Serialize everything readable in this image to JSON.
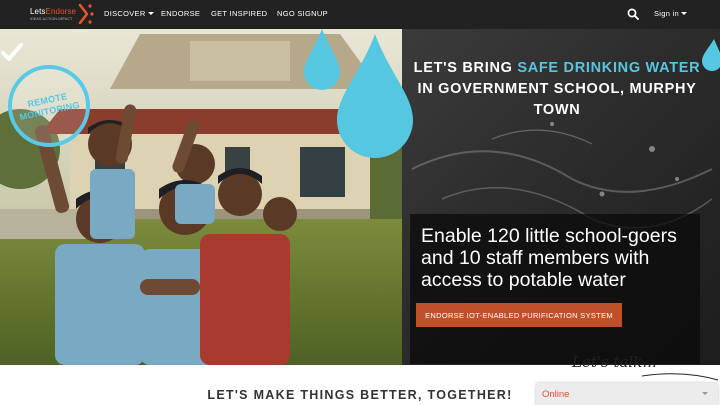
{
  "brand": {
    "name_part1": "Lets",
    "name_part2": "Endorse",
    "tagline": "IDEAS.ACTION.IMPACT",
    "accent": "#e8542a"
  },
  "nav": {
    "items": [
      {
        "label": "DISCOVER",
        "has_dropdown": true
      },
      {
        "label": "ENDORSE",
        "has_dropdown": false
      },
      {
        "label": "GET INSPIRED",
        "has_dropdown": false
      },
      {
        "label": "NGO SIGNUP",
        "has_dropdown": false
      }
    ],
    "search_icon": "search-icon",
    "signin_label": "Sign in"
  },
  "hero": {
    "badge": {
      "line1": "REMOTE",
      "line2": "MONITORING",
      "color": "#56c7e0"
    },
    "headline": {
      "part1": "LET'S BRING ",
      "highlight": "SAFE DRINKING WATER",
      "part2": " IN GOVERNMENT SCHOOL, MURPHY TOWN",
      "highlight_color": "#56c7e0"
    },
    "cta_text": "Enable 120 little school-goers and 10 staff members with access to potable water",
    "cta_button": "ENDORSE IOT-ENABLED PURIFICATION SYSTEM",
    "cta_button_color": "#c0502a"
  },
  "section": {
    "title": "LET'S MAKE THINGS BETTER, TOGETHER!"
  },
  "chat": {
    "title": "Let's talk...",
    "status": "Online",
    "status_color": "#e64b2b"
  }
}
